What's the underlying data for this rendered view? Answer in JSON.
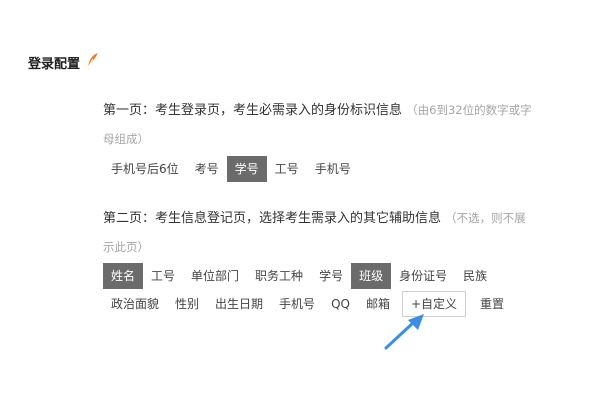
{
  "page": {
    "title": "登录配置"
  },
  "section1": {
    "desc": "第一页：考生登录页，考生必需录入的身份标识信息",
    "hint_line1": "（由6到32位的数字或字",
    "hint_line2": "母组成）",
    "chips": [
      {
        "label": "手机号后6位",
        "selected": false
      },
      {
        "label": "考号",
        "selected": false
      },
      {
        "label": "学号",
        "selected": true
      },
      {
        "label": "工号",
        "selected": false
      },
      {
        "label": "手机号",
        "selected": false
      }
    ]
  },
  "section2": {
    "desc": "第二页：考生信息登记页，选择考生需录入的其它辅助信息",
    "hint_line1": "（不选，则不展",
    "hint_line2": "示此页）",
    "row1": [
      {
        "label": "姓名",
        "selected": true
      },
      {
        "label": "工号",
        "selected": false
      },
      {
        "label": "单位部门",
        "selected": false
      },
      {
        "label": "职务工种",
        "selected": false
      },
      {
        "label": "学号",
        "selected": false
      },
      {
        "label": "班级",
        "selected": true
      },
      {
        "label": "身份证号",
        "selected": false
      },
      {
        "label": "民族",
        "selected": false
      }
    ],
    "row2": [
      {
        "label": "政治面貌",
        "selected": false
      },
      {
        "label": "性别",
        "selected": false
      },
      {
        "label": "出生日期",
        "selected": false
      },
      {
        "label": "手机号",
        "selected": false
      },
      {
        "label": "QQ",
        "selected": false
      },
      {
        "label": "邮箱",
        "selected": false
      }
    ],
    "custom_label": "+自定义",
    "reset_label": "重置"
  },
  "colors": {
    "selected_bg": "#6b6b6b",
    "feather": "#f07a2a",
    "arrow": "#3a8ee6"
  },
  "icons": {
    "title_icon": "feather-pen-icon",
    "pointer": "arrow-pointer-icon"
  }
}
